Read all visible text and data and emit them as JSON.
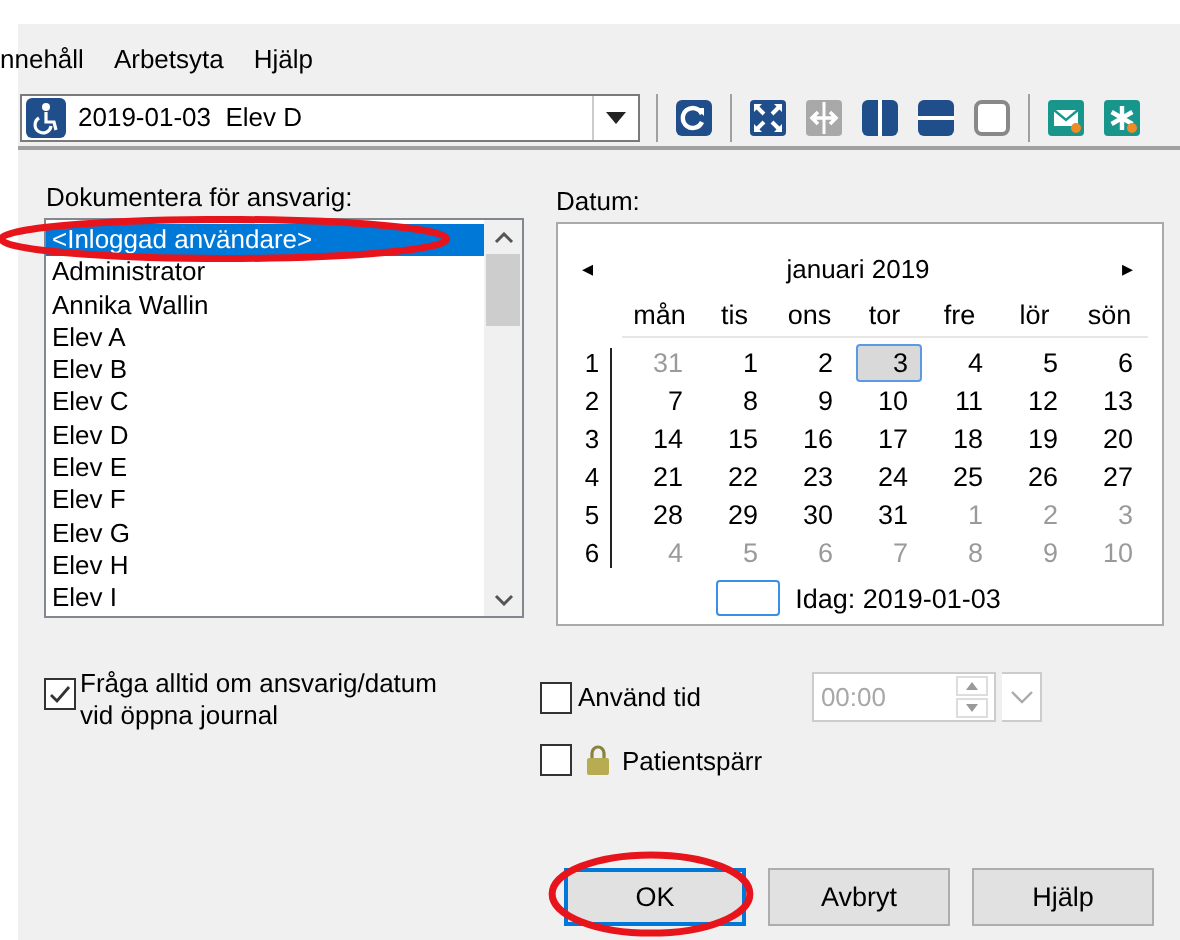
{
  "menu": [
    {
      "label": "nnehåll"
    },
    {
      "label": "Arbetsyta"
    },
    {
      "label": "Hjälp"
    }
  ],
  "toolbar": {
    "combo_value": "2019-01-03  Elev D",
    "tools": [
      {
        "kind": "refresh",
        "disabled": false
      },
      {
        "kind": "expand",
        "disabled": false
      },
      {
        "kind": "split",
        "disabled": true
      },
      {
        "kind": "columns",
        "disabled": false
      },
      {
        "kind": "rows",
        "disabled": false
      },
      {
        "kind": "single",
        "disabled": false
      },
      {
        "kind": "mail",
        "disabled": false
      },
      {
        "kind": "asterisk",
        "disabled": false
      }
    ]
  },
  "responsible": {
    "label": "Dokumentera för ansvarig:",
    "items": [
      {
        "label": "<Inloggad användare>",
        "selected": true,
        "circled": true
      },
      {
        "label": "Administrator",
        "selected": false,
        "circled": false
      },
      {
        "label": "Annika Wallin",
        "selected": false,
        "circled": false
      },
      {
        "label": "Elev A",
        "selected": false,
        "circled": false
      },
      {
        "label": "Elev B",
        "selected": false,
        "circled": false
      },
      {
        "label": "Elev C",
        "selected": false,
        "circled": false
      },
      {
        "label": "Elev D",
        "selected": false,
        "circled": false
      },
      {
        "label": "Elev E",
        "selected": false,
        "circled": false
      },
      {
        "label": "Elev F",
        "selected": false,
        "circled": false
      },
      {
        "label": "Elev G",
        "selected": false,
        "circled": false
      },
      {
        "label": "Elev H",
        "selected": false,
        "circled": false
      },
      {
        "label": "Elev I",
        "selected": false,
        "circled": false
      }
    ]
  },
  "date": {
    "label": "Datum:",
    "month": "januari 2019",
    "prev": "◂",
    "next": "▸",
    "weekdays": [
      "mån",
      "tis",
      "ons",
      "tor",
      "fre",
      "lör",
      "sön"
    ],
    "weeks": [
      {
        "number": "1",
        "days": [
          {
            "label": "31",
            "other_month": true,
            "selected": false
          },
          {
            "label": "1",
            "other_month": false,
            "selected": false
          },
          {
            "label": "2",
            "other_month": false,
            "selected": false
          },
          {
            "label": "3",
            "other_month": false,
            "selected": true
          },
          {
            "label": "4",
            "other_month": false,
            "selected": false
          },
          {
            "label": "5",
            "other_month": false,
            "selected": false
          },
          {
            "label": "6",
            "other_month": false,
            "selected": false
          }
        ]
      },
      {
        "number": "2",
        "days": [
          {
            "label": "7",
            "other_month": false,
            "selected": false
          },
          {
            "label": "8",
            "other_month": false,
            "selected": false
          },
          {
            "label": "9",
            "other_month": false,
            "selected": false
          },
          {
            "label": "10",
            "other_month": false,
            "selected": false
          },
          {
            "label": "11",
            "other_month": false,
            "selected": false
          },
          {
            "label": "12",
            "other_month": false,
            "selected": false
          },
          {
            "label": "13",
            "other_month": false,
            "selected": false
          }
        ]
      },
      {
        "number": "3",
        "days": [
          {
            "label": "14",
            "other_month": false,
            "selected": false
          },
          {
            "label": "15",
            "other_month": false,
            "selected": false
          },
          {
            "label": "16",
            "other_month": false,
            "selected": false
          },
          {
            "label": "17",
            "other_month": false,
            "selected": false
          },
          {
            "label": "18",
            "other_month": false,
            "selected": false
          },
          {
            "label": "19",
            "other_month": false,
            "selected": false
          },
          {
            "label": "20",
            "other_month": false,
            "selected": false
          }
        ]
      },
      {
        "number": "4",
        "days": [
          {
            "label": "21",
            "other_month": false,
            "selected": false
          },
          {
            "label": "22",
            "other_month": false,
            "selected": false
          },
          {
            "label": "23",
            "other_month": false,
            "selected": false
          },
          {
            "label": "24",
            "other_month": false,
            "selected": false
          },
          {
            "label": "25",
            "other_month": false,
            "selected": false
          },
          {
            "label": "26",
            "other_month": false,
            "selected": false
          },
          {
            "label": "27",
            "other_month": false,
            "selected": false
          }
        ]
      },
      {
        "number": "5",
        "days": [
          {
            "label": "28",
            "other_month": false,
            "selected": false
          },
          {
            "label": "29",
            "other_month": false,
            "selected": false
          },
          {
            "label": "30",
            "other_month": false,
            "selected": false
          },
          {
            "label": "31",
            "other_month": false,
            "selected": false
          },
          {
            "label": "1",
            "other_month": true,
            "selected": false
          },
          {
            "label": "2",
            "other_month": true,
            "selected": false
          },
          {
            "label": "3",
            "other_month": true,
            "selected": false
          }
        ]
      },
      {
        "number": "6",
        "days": [
          {
            "label": "4",
            "other_month": true,
            "selected": false
          },
          {
            "label": "5",
            "other_month": true,
            "selected": false
          },
          {
            "label": "6",
            "other_month": true,
            "selected": false
          },
          {
            "label": "7",
            "other_month": true,
            "selected": false
          },
          {
            "label": "8",
            "other_month": true,
            "selected": false
          },
          {
            "label": "9",
            "other_month": true,
            "selected": false
          },
          {
            "label": "10",
            "other_month": true,
            "selected": false
          }
        ]
      }
    ],
    "today": "Idag: 2019-01-03"
  },
  "always_ask": {
    "label": "Fråga alltid om ansvarig/datum vid öppna journal",
    "checked": true
  },
  "use_time": {
    "label": "Använd tid",
    "checked": false,
    "time": "00:00",
    "disabled": true
  },
  "patient_lock": {
    "label": "Patientspärr",
    "checked": false
  },
  "buttons": [
    {
      "label": "OK",
      "default": true,
      "circled": true
    },
    {
      "label": "Avbryt",
      "default": false,
      "circled": false
    },
    {
      "label": "Hjälp",
      "default": false,
      "circled": false
    }
  ]
}
